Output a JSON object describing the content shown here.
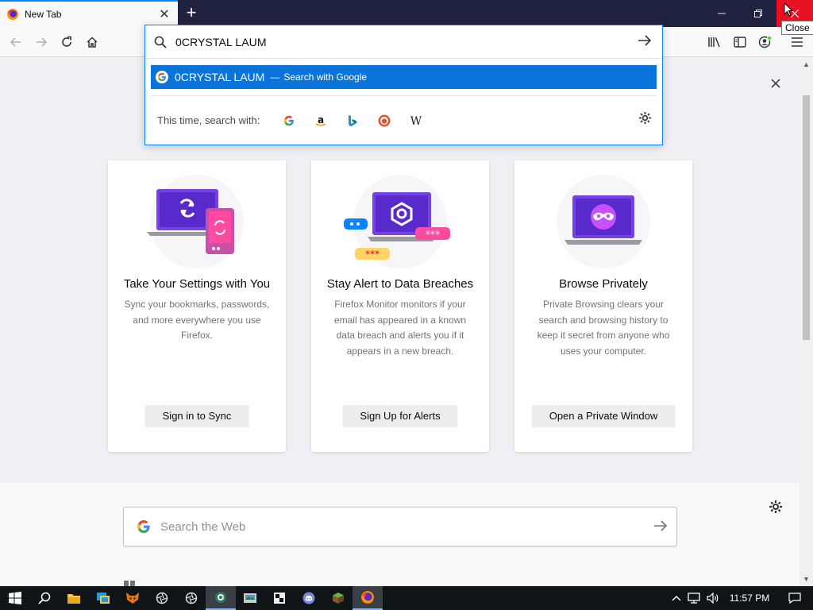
{
  "browser": {
    "tab": {
      "title": "New Tab",
      "close": "✕"
    },
    "new_tab": "+",
    "window_controls": {
      "minimize": "—",
      "restore": "❐",
      "close": "✕"
    },
    "tooltip": "Close"
  },
  "urlbar": {
    "value": "0CRYSTAL LAUM",
    "suggestion": {
      "query": "0CRYSTAL LAUM",
      "separator": "—",
      "action": "Search with Google"
    },
    "one_off_label": "This time, search with:",
    "engines": [
      "google-icon",
      "amazon-icon",
      "bing-icon",
      "duckduckgo-icon",
      "wikipedia-icon"
    ]
  },
  "cards": [
    {
      "title": "Take Your Settings with You",
      "description": "Sync your bookmarks, passwords, and more everywhere you use Firefox.",
      "button": "Sign in to Sync"
    },
    {
      "title": "Stay Alert to Data Breaches",
      "description": "Firefox Monitor monitors if your email has appeared in a known data breach and alerts you if it appears in a new breach.",
      "button": "Sign Up for Alerts"
    },
    {
      "title": "Browse Privately",
      "description": "Private Browsing clears your search and browsing history to keep it secret from anyone who uses your computer.",
      "button": "Open a Private Window"
    }
  ],
  "websearch": {
    "placeholder": "Search the Web"
  },
  "taskbar": {
    "time": "11:57 PM"
  },
  "colors": {
    "accent": "#0a84ff",
    "highlight": "#0a74da",
    "tab_strip": "#202340",
    "close_red": "#e81123",
    "purple": "#7542e5",
    "pink": "#ff4aa2"
  }
}
